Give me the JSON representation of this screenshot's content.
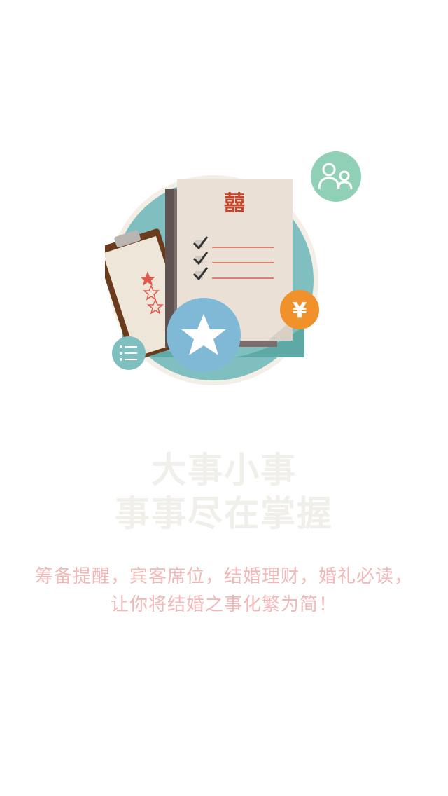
{
  "illustration": {
    "document_char": "囍",
    "coin_symbol": "¥",
    "icons": [
      "people-icon",
      "list-icon",
      "star-icon",
      "checklist-icon",
      "yen-icon"
    ],
    "colors": {
      "teal": "#7fbfc0",
      "mint": "#8fd0b6",
      "blue": "#7fb9d6",
      "orange": "#f0912c",
      "paper": "#eae0d5",
      "brown": "#6b3b1e",
      "red": "#e05a4f"
    }
  },
  "headline": {
    "line1": "大事小事",
    "line2": "事事尽在掌握"
  },
  "subtext": {
    "line1": "筹备提醒，宾客席位，结婚理财，婚礼必读，",
    "line2": "让你将结婚之事化繁为简！"
  }
}
